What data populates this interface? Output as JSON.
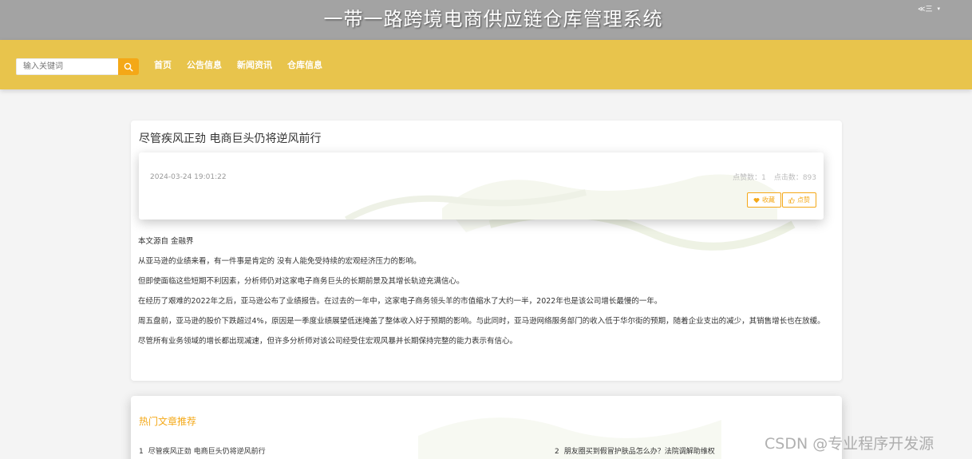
{
  "header": {
    "title": "一带一路跨境电商供应链仓库管理系统",
    "user_menu_label": "≪三",
    "user_menu_caret": "▾"
  },
  "nav": {
    "search_placeholder": "输入关键词",
    "links": [
      "首页",
      "公告信息",
      "新闻资讯",
      "仓库信息"
    ]
  },
  "article": {
    "title": "尽管疾风正劲 电商巨头仍将逆风前行",
    "date": "2024-03-24 19:01:22",
    "likes_label": "点赞数：1",
    "clicks_label": "点击数：893",
    "favorite_label": "收藏",
    "like_label": "点赞",
    "paragraphs": [
      "本文源自 金融界",
      "从亚马逊的业绩来看，有一件事是肯定的 没有人能免受持续的宏观经济压力的影响。",
      "但即使面临这些短期不利因素，分析师仍对这家电子商务巨头的长期前景及其增长轨迹充满信心。",
      "在经历了艰难的2022年之后，亚马逊公布了业绩报告。在过去的一年中，这家电子商务领头羊的市值缩水了大约一半，2022年也是该公司增长最慢的一年。",
      "周五盘前，亚马逊的股价下跌超过4%，原因是一季度业绩展望低迷掩盖了整体收入好于预期的影响。与此同时，亚马逊网络服务部门的收入低于华尔街的预期，随着企业支出的减少，其销售增长也在放缓。",
      "尽管所有业务领域的增长都出现减速，但许多分析师对该公司经受住宏观风暴并长期保持完整的能力表示有信心。"
    ]
  },
  "hot": {
    "title": "热门文章推荐",
    "items": [
      {
        "num": "1",
        "text": "尽管疾风正劲 电商巨头仍将逆风前行"
      },
      {
        "num": "2",
        "text": "朋友圈买到假冒护肤品怎么办？法院调解助维权"
      }
    ]
  },
  "watermark": "CSDN @专业程序开发源",
  "colors": {
    "topbar": "#a3a3a3",
    "navbar": "#e8c44c",
    "accent": "#f4a817"
  },
  "icons": {
    "search": "search-icon",
    "heart": "heart-icon",
    "thumb": "thumbs-up-icon"
  }
}
